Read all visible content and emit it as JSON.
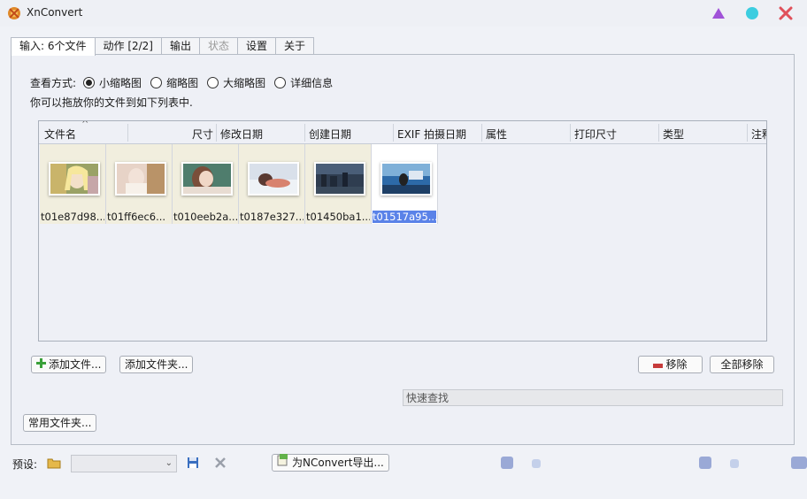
{
  "app": {
    "title": "XnConvert"
  },
  "tabs": [
    {
      "label": "输入:  6个文件",
      "state": "active"
    },
    {
      "label": "动作 [2/2]",
      "state": "normal"
    },
    {
      "label": "输出",
      "state": "normal"
    },
    {
      "label": "状态",
      "state": "disabled"
    },
    {
      "label": "设置",
      "state": "normal"
    },
    {
      "label": "关于",
      "state": "normal"
    }
  ],
  "view_mode": {
    "label": "查看方式:",
    "options": [
      "小缩略图",
      "缩略图",
      "大缩略图",
      "详细信息"
    ],
    "selected": "小缩略图"
  },
  "hint": "你可以拖放你的文件到如下列表中.",
  "list": {
    "columns": [
      "文件名",
      "尺寸",
      "修改日期",
      "创建日期",
      "EXIF 拍摄日期",
      "属性",
      "打印尺寸",
      "类型",
      "注释"
    ],
    "files": [
      {
        "name": "t01e87d98...",
        "selected": false
      },
      {
        "name": "t01ff6ec6...",
        "selected": false
      },
      {
        "name": "t010eeb2a...",
        "selected": false
      },
      {
        "name": "t0187e327...",
        "selected": false
      },
      {
        "name": "t01450ba1...",
        "selected": false
      },
      {
        "name": "t01517a95...",
        "selected": true
      }
    ]
  },
  "buttons": {
    "add_files": "添加文件...",
    "add_folder": "添加文件夹...",
    "remove": "移除",
    "remove_all": "全部移除",
    "common_folders": "常用文件夹...",
    "export": "为NConvert导出..."
  },
  "search": {
    "placeholder": "快速查找"
  },
  "presets": {
    "label": "预设:",
    "value": ""
  },
  "icons": {
    "add": "plus-icon",
    "remove": "minus-icon",
    "folder": "folder-icon",
    "save": "save-icon",
    "delete": "delete-icon",
    "export": "export-icon"
  },
  "colors": {
    "accent": "#5a82e8",
    "title_close": "#e0505a",
    "title_min": "#a052d8",
    "title_max": "#3ccde0"
  }
}
